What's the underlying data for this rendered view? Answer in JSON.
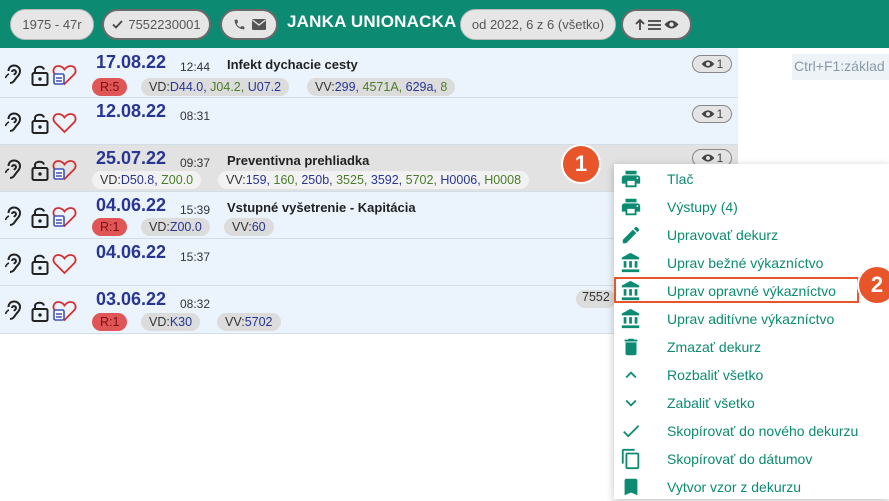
{
  "header": {
    "birth": "1975 - 47r",
    "phone": "7552230001",
    "patient_name": "JANKA UNIONACKA",
    "filter": "od 2022, 6 z 6 (všetko)"
  },
  "hint": "Ctrl+F1:základ",
  "rows": [
    {
      "date": "17.08.22",
      "time": "12:44",
      "title": "Infekt dychacie cesty",
      "eye": "1",
      "r": "R:5",
      "vd_prefix": "VD:",
      "vd": [
        {
          "t": "D44.0,",
          "c": "b"
        },
        {
          "t": "J04.2,",
          "c": "g"
        },
        {
          "t": "U07.2",
          "c": "b"
        }
      ],
      "vv_prefix": "VV:",
      "vv": [
        {
          "t": "299,",
          "c": "b"
        },
        {
          "t": "4571A,",
          "c": "g"
        },
        {
          "t": "629a,",
          "c": "b"
        },
        {
          "t": "8",
          "c": "g"
        }
      ]
    },
    {
      "date": "12.08.22",
      "time": "08:31",
      "eye": "1"
    },
    {
      "date": "25.07.22",
      "time": "09:37",
      "title": "Preventivna prehliadka",
      "eye": "1",
      "vd_prefix": "VD:",
      "vd": [
        {
          "t": "D50.8,",
          "c": "b"
        },
        {
          "t": "Z00.0",
          "c": "g"
        }
      ],
      "vv_prefix": "VV:",
      "vv": [
        {
          "t": "159,",
          "c": "b"
        },
        {
          "t": "160,",
          "c": "g"
        },
        {
          "t": "250b,",
          "c": "b"
        },
        {
          "t": "3525,",
          "c": "g"
        },
        {
          "t": "3592,",
          "c": "b"
        },
        {
          "t": "5702,",
          "c": "g"
        },
        {
          "t": "H0006,",
          "c": "b"
        },
        {
          "t": "H0008",
          "c": "g"
        }
      ]
    },
    {
      "date": "04.06.22",
      "time": "15:39",
      "title": "Vstupné vyšetrenie - Kapitácia",
      "r": "R:1",
      "vd_prefix": "VD:",
      "vd": [
        {
          "t": "Z00.0",
          "c": "b"
        }
      ],
      "vv_prefix": "VV:",
      "vv": [
        {
          "t": "60",
          "c": "b"
        }
      ]
    },
    {
      "date": "04.06.22",
      "time": "15:37"
    },
    {
      "date": "03.06.22",
      "time": "08:32",
      "r": "R:1",
      "phone_chip": "7552",
      "vd_prefix": "VD:",
      "vd": [
        {
          "t": "K30",
          "c": "b"
        }
      ],
      "vv_prefix": "VV:",
      "vv": [
        {
          "t": "5702",
          "c": "b"
        }
      ]
    }
  ],
  "menu": {
    "items": [
      {
        "label": "Tlač",
        "icon": "printer-icon"
      },
      {
        "label": "Výstupy (4)",
        "icon": "printer-icon"
      },
      {
        "label": "Upravovať dekurz",
        "icon": "pencil-icon"
      },
      {
        "label": "Uprav bežné výkazníctvo",
        "icon": "bank-icon"
      },
      {
        "label": "Uprav opravné výkazníctvo",
        "icon": "bank-icon"
      },
      {
        "label": "Uprav aditívne výkazníctvo",
        "icon": "bank-icon"
      },
      {
        "label": "Zmazať dekurz",
        "icon": "trash-icon"
      },
      {
        "label": "Rozbaliť všetko",
        "icon": "chevron-up-icon"
      },
      {
        "label": "Zabaliť všetko",
        "icon": "chevron-down-icon"
      },
      {
        "label": "Skopírovať do nového dekurzu",
        "icon": "check-icon"
      },
      {
        "label": "Skopírovať do dátumov",
        "icon": "copy-icon"
      },
      {
        "label": "Vytvor vzor z dekurzu",
        "icon": "bookmark-icon"
      }
    ]
  },
  "annotations": {
    "badge1": "1",
    "badge2": "2"
  },
  "colors": {
    "accent": "#0d8a72",
    "date": "#283593",
    "highlight": "#e8552a",
    "green_code": "#4a7d2a"
  }
}
